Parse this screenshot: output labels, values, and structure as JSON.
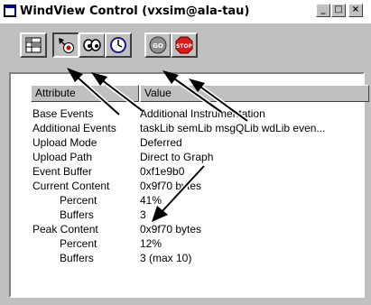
{
  "window": {
    "title": "WindView Control (vxsim@ala-tau)",
    "minimize_label": "_",
    "maximize_label": "□",
    "close_label": "×"
  },
  "toolbar": {
    "buttons": [
      {
        "name": "config-button",
        "icon": "grid-icon"
      },
      {
        "name": "event-button",
        "icon": "arrow-target-icon"
      },
      {
        "name": "view-button",
        "icon": "eyes-icon"
      },
      {
        "name": "clock-button",
        "icon": "clock-icon"
      },
      {
        "name": "go-button",
        "icon": "go-icon",
        "label": "GO"
      },
      {
        "name": "stop-button",
        "icon": "stop-icon",
        "label": "STOP"
      }
    ]
  },
  "table": {
    "columns": [
      "Attribute",
      "Value"
    ],
    "rows": [
      {
        "attr": "Base Events",
        "value": "Additional Instrumentation",
        "indent": false
      },
      {
        "attr": "Additional Events",
        "value": "taskLib semLib msgQLib wdLib even...",
        "indent": false
      },
      {
        "attr": "Upload Mode",
        "value": "Deferred",
        "indent": false
      },
      {
        "attr": "Upload Path",
        "value": "Direct to Graph",
        "indent": false
      },
      {
        "attr": "Event Buffer",
        "value": "0xf1e9b0",
        "indent": false
      },
      {
        "attr": "Current Content",
        "value": "0x9f70 bytes",
        "indent": false
      },
      {
        "attr": "Percent",
        "value": "41%",
        "indent": true
      },
      {
        "attr": "Buffers",
        "value": "3",
        "indent": true
      },
      {
        "attr": "Peak Content",
        "value": "0x9f70 bytes",
        "indent": false
      },
      {
        "attr": "Percent",
        "value": "12%",
        "indent": true
      },
      {
        "attr": "Buffers",
        "value": "3 (max 10)",
        "indent": true
      }
    ]
  },
  "colors": {
    "face": "#c0c0c0",
    "highlight": "#ffffff",
    "shadow": "#404040",
    "go": "#c02020",
    "stop": "#e01818"
  }
}
